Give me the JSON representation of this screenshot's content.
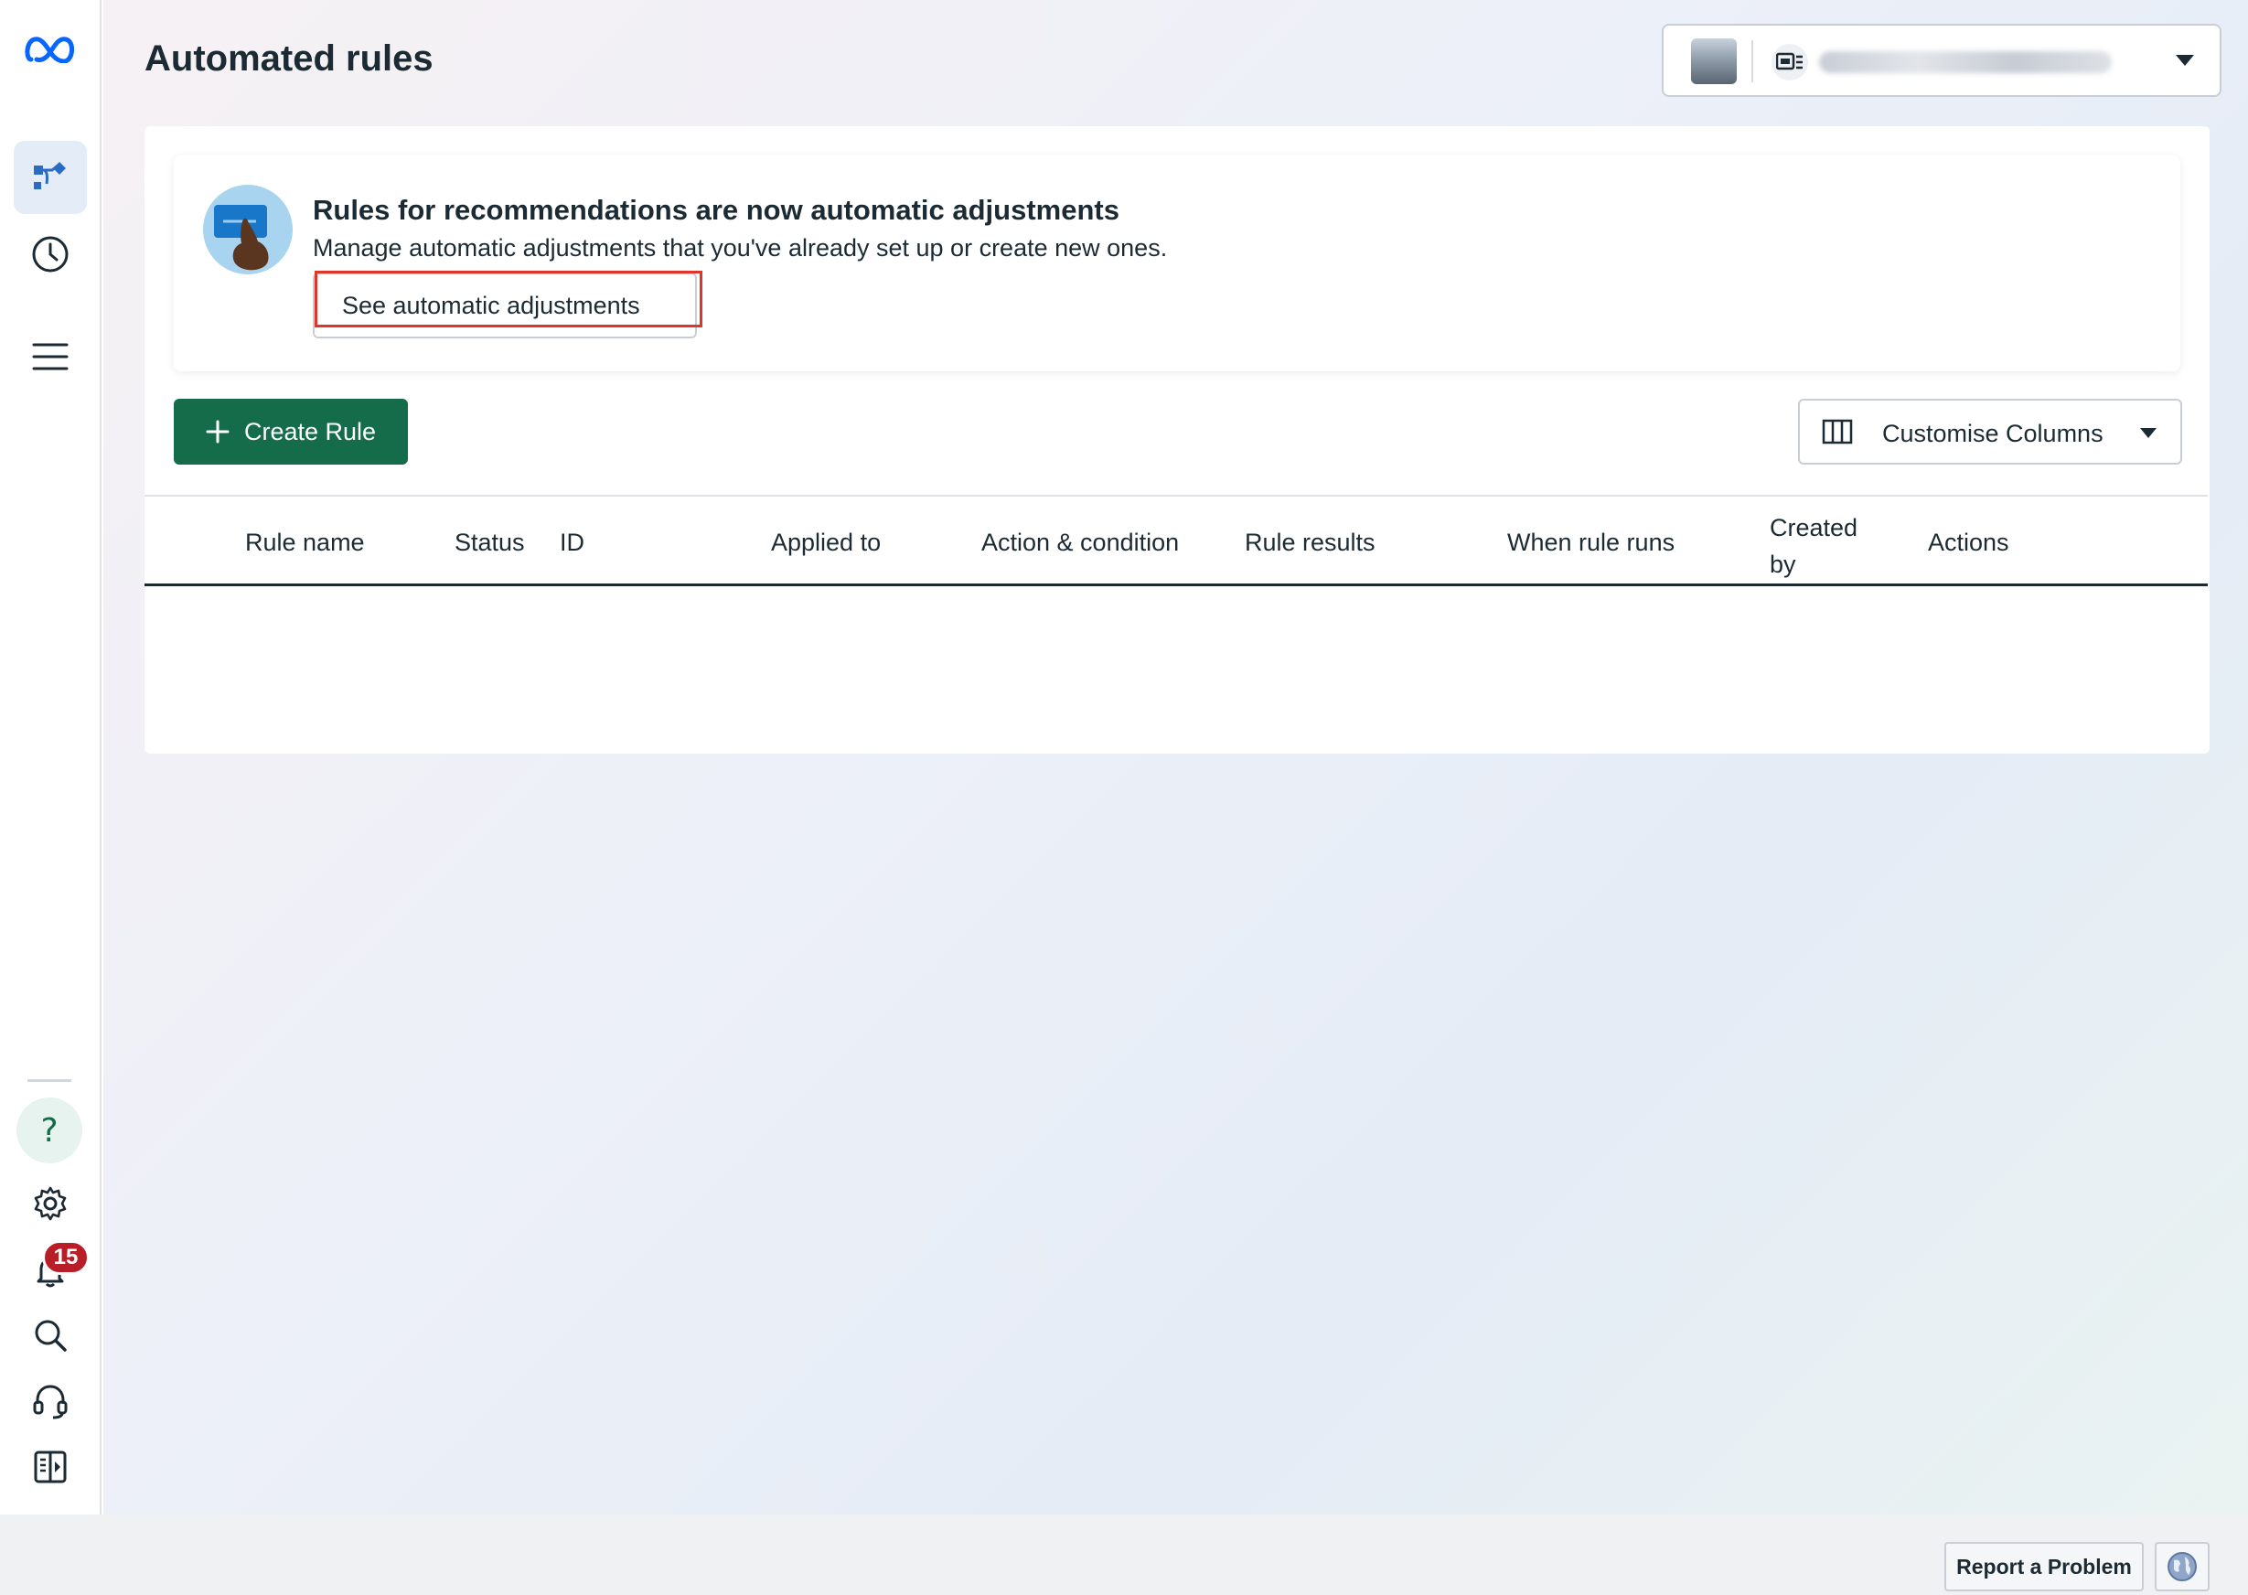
{
  "page": {
    "title": "Automated rules"
  },
  "sidebar": {
    "items": [
      {
        "icon": "meta-logo-icon"
      },
      {
        "icon": "rules-flow-icon",
        "active": true
      },
      {
        "icon": "clock-icon"
      },
      {
        "icon": "menu-icon"
      },
      {
        "icon": "help-icon"
      },
      {
        "icon": "gear-icon"
      },
      {
        "icon": "bell-icon"
      },
      {
        "icon": "search-icon"
      },
      {
        "icon": "headset-icon"
      },
      {
        "icon": "panel-toggle-icon"
      }
    ],
    "notifications_count": "15"
  },
  "account_selector": {
    "icon": "ad-account-icon"
  },
  "notice": {
    "title": "Rules for recommendations are now automatic adjustments",
    "description": "Manage automatic adjustments that you've already set up or create new ones.",
    "button_label": "See automatic adjustments"
  },
  "toolbar": {
    "create_rule_label": "Create Rule",
    "customise_columns_label": "Customise Columns"
  },
  "table": {
    "columns": [
      "Rule name",
      "Status",
      "ID",
      "Applied to",
      "Action & condition",
      "Rule results",
      "When rule runs",
      "Created by",
      "Actions"
    ],
    "rows": []
  },
  "footer": {
    "report_problem_label": "Report a Problem"
  },
  "colors": {
    "primary_green": "#156c4a",
    "highlight_red": "#e0352b",
    "badge_red": "#b91d27",
    "meta_blue": "#0866ff"
  }
}
